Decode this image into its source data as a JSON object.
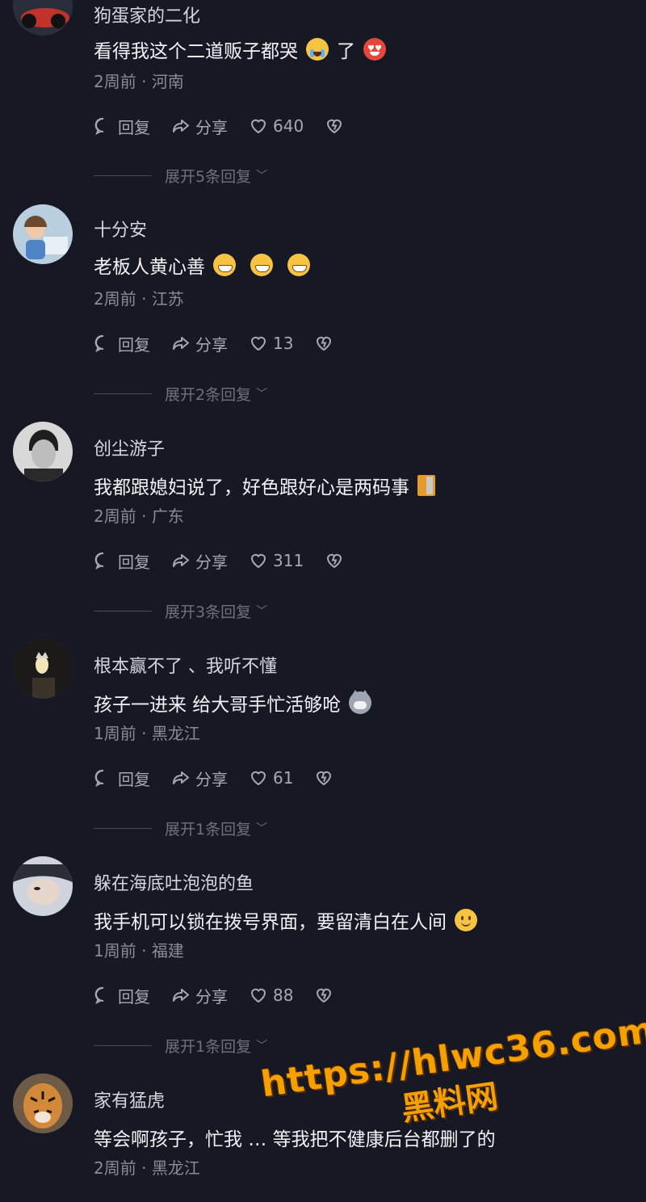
{
  "actions": {
    "reply": "回复",
    "share": "分享"
  },
  "comments": [
    {
      "username": "狗蛋家的二化",
      "text": "看得我这个二道贩子都哭",
      "text_after": "了",
      "time": "2周前",
      "location": "河南",
      "likes": "640",
      "expand": "展开5条回复",
      "emojis": [
        "crying-face-emoji",
        "heart-eyes-emoji"
      ]
    },
    {
      "username": "十分安",
      "text": "老板人黄心善",
      "time": "2周前",
      "location": "江苏",
      "likes": "13",
      "expand": "展开2条回复",
      "emojis": [
        "grin-emoji",
        "grin-emoji",
        "grin-emoji"
      ]
    },
    {
      "username": "创尘游子",
      "text": "我都跟媳妇说了，好色跟好心是两码事",
      "time": "2周前",
      "location": "广东",
      "likes": "311",
      "expand": "展开3条回复",
      "emojis": [
        "door-emoji"
      ]
    },
    {
      "username": "根本赢不了 、我听不懂",
      "text": "孩子一进来 给大哥手忙活够呛",
      "time": "1周前",
      "location": "黑龙江",
      "likes": "61",
      "expand": "展开1条回复",
      "emojis": [
        "cat-emoji"
      ]
    },
    {
      "username": "躲在海底吐泡泡的鱼",
      "text": "我手机可以锁在拨号界面，要留清白在人间",
      "time": "1周前",
      "location": "福建",
      "likes": "88",
      "expand": "展开1条回复",
      "emojis": [
        "slight-smile-emoji"
      ]
    },
    {
      "username": "家有猛虎",
      "text": "等会啊孩子，忙我 … 等我把不健康后台都删了的",
      "time": "2周前",
      "location": "黑龙江"
    }
  ],
  "watermark": {
    "url": "https://hlwc36.com",
    "name": "黑料网"
  },
  "colors": {
    "background": "#161823",
    "accent": "#f4a000"
  }
}
